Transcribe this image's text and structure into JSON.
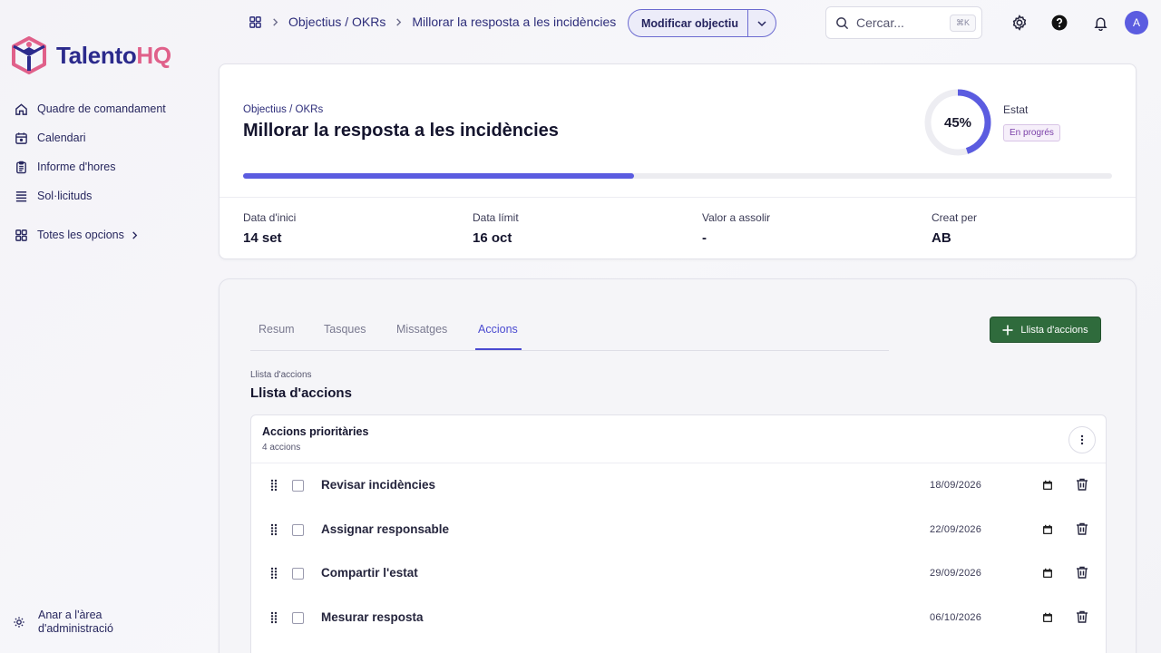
{
  "brand": {
    "name_part1": "Talento",
    "name_part2": "HQ",
    "color_primary": "#2b2a8c",
    "color_accent": "#e0608a"
  },
  "sidebar": {
    "items": [
      {
        "label": "Quadre de comandament",
        "icon": "home-icon"
      },
      {
        "label": "Calendari",
        "icon": "calendar-icon"
      },
      {
        "label": "Informe d'hores",
        "icon": "clipboard-icon"
      },
      {
        "label": "Sol·licituds",
        "icon": "list-icon"
      }
    ],
    "all_options": "Totes les opcions",
    "admin": {
      "line1": "Anar a l'àrea",
      "line2": "d'administració"
    }
  },
  "topbar": {
    "breadcrumb": [
      "Objectius / OKRs",
      "Millorar la resposta a les incidències"
    ],
    "modify_button": "Modificar objectiu",
    "search": {
      "placeholder": "Cercar...",
      "shortcut": "⌘K"
    },
    "avatar": "A"
  },
  "objective": {
    "category": "Objectius / OKRs",
    "title": "Millorar la resposta a les incidències",
    "progress_percent": 45,
    "progress_label": "45%",
    "status_label": "Estat",
    "status_value": "En progrés",
    "meta": [
      {
        "key": "Data d'inici",
        "value": "14 set"
      },
      {
        "key": "Data límit",
        "value": "16 oct"
      },
      {
        "key": "Valor a assolir",
        "value": "-"
      },
      {
        "key": "Creat per",
        "value": "AB"
      }
    ]
  },
  "tabs": [
    {
      "label": "Resum",
      "active": false
    },
    {
      "label": "Tasques",
      "active": false
    },
    {
      "label": "Missatges",
      "active": false
    },
    {
      "label": "Accions",
      "active": true
    }
  ],
  "add_button": "Llista d'accions",
  "section": {
    "subtitle": "Llista d'accions",
    "title": "Llista d'accions",
    "list": {
      "title": "Accions prioritàries",
      "count": "4 accions",
      "rows": [
        {
          "name": "Revisar incidències",
          "date": "18/09/2026"
        },
        {
          "name": "Assignar responsable",
          "date": "22/09/2026"
        },
        {
          "name": "Compartir l'estat",
          "date": "29/09/2026"
        },
        {
          "name": "Mesurar resposta",
          "date": "06/10/2026"
        }
      ]
    }
  }
}
